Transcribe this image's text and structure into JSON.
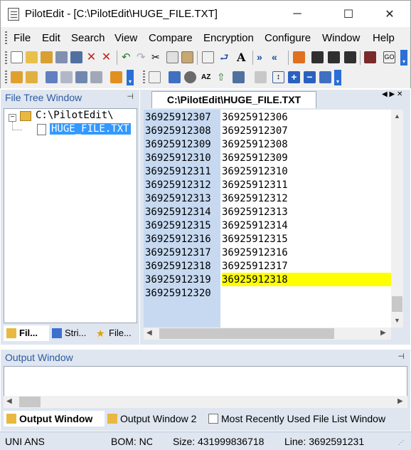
{
  "window": {
    "title": "PilotEdit - [C:\\PilotEdit\\HUGE_FILE.TXT]",
    "minimize": "─",
    "maximize": "☐",
    "close": "✕"
  },
  "menubar": {
    "items": [
      "File",
      "Edit",
      "Search",
      "View",
      "Compare",
      "Encryption",
      "Configure",
      "Window",
      "Help"
    ]
  },
  "file_tree": {
    "title": "File Tree Window",
    "pin": "ᵖ",
    "root": "C:\\PilotEdit\\",
    "file": "HUGE_FILE.TXT",
    "tabs": [
      "Fil...",
      "Stri...",
      "File..."
    ]
  },
  "editor": {
    "tab_title": "C:\\PilotEdit\\HUGE_FILE.TXT",
    "nav": "◀ ▶ ✕",
    "line_numbers": [
      "36925912307",
      "36925912308",
      "36925912309",
      "36925912310",
      "36925912311",
      "36925912312",
      "36925912313",
      "36925912314",
      "36925912315",
      "36925912316",
      "36925912317",
      "36925912318",
      "36925912319",
      "36925912320"
    ],
    "lines": [
      "36925912306",
      "36925912307",
      "36925912308",
      "36925912309",
      "36925912310",
      "36925912311",
      "36925912312",
      "36925912313",
      "36925912314",
      "36925912315",
      "36925912316",
      "36925912317",
      "36925912318"
    ],
    "highlight_color": "#ffff00"
  },
  "output": {
    "title": "Output Window",
    "tabs": [
      "Output Window",
      "Output Window 2",
      "Most Recently Used File List Window"
    ]
  },
  "status": {
    "encoding": "UNI ANSI",
    "bom": "BOM: NC",
    "size": "Size: 431999836718",
    "line": "Line: 3692591231"
  }
}
